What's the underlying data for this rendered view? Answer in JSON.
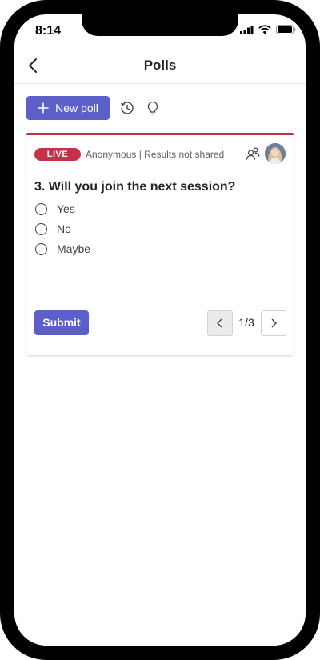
{
  "status_bar": {
    "time": "8:14"
  },
  "header": {
    "title": "Polls"
  },
  "toolbar": {
    "new_poll_label": "New poll"
  },
  "poll": {
    "badge": "LIVE",
    "meta": "Anonymous | Results not shared",
    "question": "3. Will you join the next session?",
    "options": [
      "Yes",
      "No",
      "Maybe"
    ],
    "submit_label": "Submit",
    "pager": "1/3"
  },
  "colors": {
    "accent": "#5b5fc7",
    "live": "#c4314b"
  }
}
